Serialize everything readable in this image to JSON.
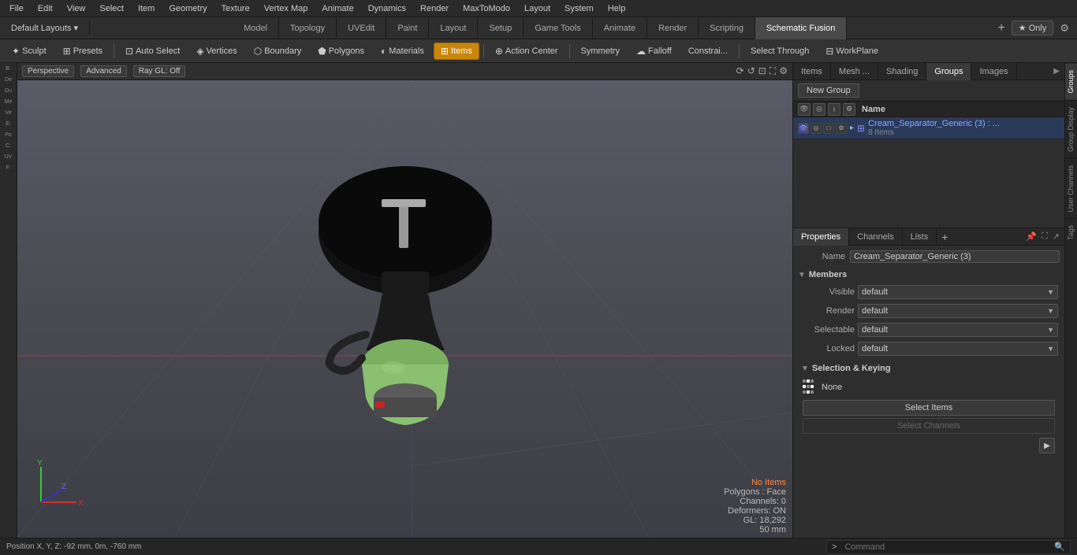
{
  "menu": {
    "items": [
      "File",
      "Edit",
      "View",
      "Select",
      "Item",
      "Geometry",
      "Texture",
      "Vertex Map",
      "Animate",
      "Dynamics",
      "Render",
      "MaxToModo",
      "Layout",
      "System",
      "Help"
    ]
  },
  "layouts_bar": {
    "left": "Default Layouts ▾",
    "tabs": [
      "Model",
      "Topology",
      "UVEdit",
      "Paint",
      "Layout",
      "Setup",
      "Game Tools",
      "Animate",
      "Render",
      "Scripting",
      "Schematic Fusion"
    ],
    "active_tab": "Schematic Fusion",
    "only_label": "★ Only",
    "plus": "+",
    "gear": "⚙"
  },
  "tools_bar": {
    "sculpt": "Sculpt",
    "presets": "Presets",
    "auto_select": "Auto Select",
    "vertices": "Vertices",
    "boundary": "Boundary",
    "polygons": "Polygons",
    "materials": "Materials",
    "items": "Items",
    "action_center": "Action Center",
    "symmetry": "Symmetry",
    "falloff": "Falloff",
    "constraints": "Constrai...",
    "select_through": "Select Through",
    "work_plane": "WorkPlane"
  },
  "viewport": {
    "perspective": "Perspective",
    "advanced": "Advanced",
    "ray_gl": "Ray GL: Off",
    "status": {
      "no_items": "No Items",
      "polygons": "Polygons : Face",
      "channels": "Channels: 0",
      "deformers": "Deformers: ON",
      "gl": "GL: 18,292",
      "mm": "50 mm"
    },
    "position": "Position X, Y, Z:   -92 mm, 0m, -760 mm"
  },
  "right_panel": {
    "tabs": [
      "Items",
      "Mesh ...",
      "Shading",
      "Groups",
      "Images"
    ],
    "active_tab": "Groups",
    "new_group_label": "New Group",
    "header_name": "Name",
    "group_item": {
      "name": "Cream_Separator_Generic (3) : ...",
      "sub": "8 Items"
    },
    "props": {
      "tabs": [
        "Properties",
        "Channels",
        "Lists"
      ],
      "active_tab": "Properties",
      "name_label": "Name",
      "name_value": "Cream_Separator_Generic (3)",
      "members_label": "Members",
      "visible_label": "Visible",
      "visible_value": "default",
      "render_label": "Render",
      "render_value": "default",
      "selectable_label": "Selectable",
      "selectable_value": "default",
      "locked_label": "Locked",
      "locked_value": "default",
      "sel_keying_label": "Selection & Keying",
      "sel_none_label": "None",
      "select_items_label": "Select Items",
      "select_channels_label": "Select Channels"
    }
  },
  "vtabs": [
    "Groups",
    "Group Display",
    "User Channels",
    "Tags"
  ],
  "command": {
    "prompt": ">",
    "placeholder": "Command"
  }
}
